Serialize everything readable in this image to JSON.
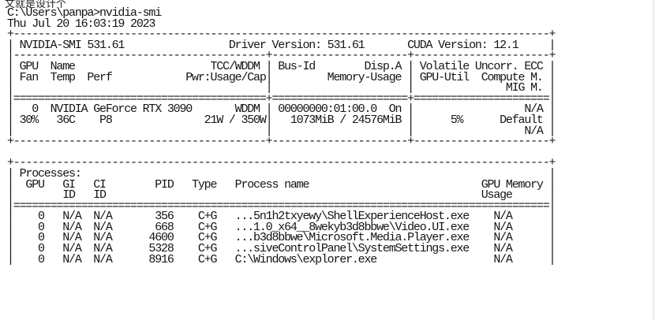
{
  "top_cutoff_text": "文就是设计个",
  "terminal_lines": [
    "C:\\Users\\panpa>nvidia-smi",
    "Thu Jul 20 16:03:19 2023",
    "+---------------------------------------------------------------------------------------+",
    "| NVIDIA-SMI 531.61                 Driver Version: 531.61       CUDA Version: 12.1     |",
    "|-----------------------------------------+----------------------+----------------------+",
    "| GPU  Name                      TCC/WDDM | Bus-Id        Disp.A | Volatile Uncorr. ECC |",
    "| Fan  Temp  Perf            Pwr:Usage/Cap|         Memory-Usage | GPU-Util  Compute M. |",
    "|                                         |                      |               MIG M. |",
    "|=========================================+======================+======================|",
    "|   0  NVIDIA GeForce RTX 3090       WDDM | 00000000:01:00.0  On |                  N/A |",
    "| 30%   36C    P8               21W / 350W|   1073MiB / 24576MiB |      5%      Default |",
    "|                                         |                      |                  N/A |",
    "+-----------------------------------------+----------------------+----------------------+",
    "",
    "+---------------------------------------------------------------------------------------+",
    "| Processes:                                                                            |",
    "|  GPU   GI   CI        PID   Type   Process name                            GPU Memory |",
    "|        ID   ID                                                             Usage      |",
    "|=======================================================================================|",
    "|    0   N/A  N/A       356    C+G   ...5n1h2txyewy\\ShellExperienceHost.exe    N/A      |",
    "|    0   N/A  N/A       668    C+G   ...1.0_x64__8wekyb3d8bbwe\\Video.UI.exe    N/A      |",
    "|    0   N/A  N/A      4600    C+G   ...b3d8bbwe\\Microsoft.Media.Player.exe    N/A      |",
    "|    0   N/A  N/A      5328    C+G   ...siveControlPanel\\SystemSettings.exe    N/A      |",
    "|    0   N/A  N/A      8916    C+G   C:\\Windows\\explorer.exe                   N/A      |"
  ]
}
